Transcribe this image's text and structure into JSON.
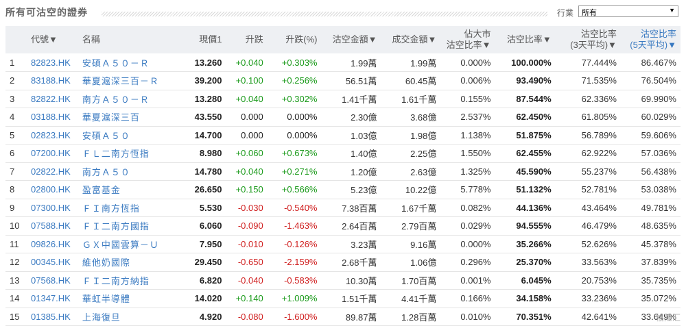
{
  "header": {
    "title": "所有可沽空的證券",
    "filter_label": "行業",
    "filter_value": "所有"
  },
  "columns": [
    {
      "key": "code",
      "label": "代號▼",
      "align": "l"
    },
    {
      "key": "name",
      "label": "名稱",
      "align": "l"
    },
    {
      "key": "price",
      "label": "現價1",
      "align": "r"
    },
    {
      "key": "chg",
      "label": "升跌",
      "align": "r"
    },
    {
      "key": "chgpct",
      "label": "升跌(%)",
      "align": "r"
    },
    {
      "key": "short_amt",
      "label": "沽空金額▼",
      "align": "r"
    },
    {
      "key": "turnover",
      "label": "成交金額▼",
      "align": "r"
    },
    {
      "key": "mkt_ratio",
      "label": "佔大市\n沽空比率▼",
      "align": "r"
    },
    {
      "key": "short_ratio",
      "label": "沽空比率▼",
      "align": "r"
    },
    {
      "key": "avg3",
      "label": "沽空比率\n(3天平均)▼",
      "align": "r"
    },
    {
      "key": "avg5",
      "label": "沽空比率\n(5天平均)▼",
      "align": "r",
      "sorted": true
    }
  ],
  "rows": [
    {
      "n": "1",
      "code": "82823.HK",
      "name": "安碩Ａ５０－Ｒ",
      "price": "13.260",
      "chg": "+0.040",
      "chgpct": "+0.303%",
      "dir": "up",
      "short_amt": "1.99萬",
      "turnover": "1.99萬",
      "mkt_ratio": "0.000%",
      "short_ratio": "100.000%",
      "avg3": "77.444%",
      "avg5": "86.467%"
    },
    {
      "n": "2",
      "code": "83188.HK",
      "name": "華夏滬深三百－Ｒ",
      "price": "39.200",
      "chg": "+0.100",
      "chgpct": "+0.256%",
      "dir": "up",
      "short_amt": "56.51萬",
      "turnover": "60.45萬",
      "mkt_ratio": "0.006%",
      "short_ratio": "93.490%",
      "avg3": "71.535%",
      "avg5": "76.504%"
    },
    {
      "n": "3",
      "code": "82822.HK",
      "name": "南方Ａ５０－Ｒ",
      "price": "13.280",
      "chg": "+0.040",
      "chgpct": "+0.302%",
      "dir": "up",
      "short_amt": "1.41千萬",
      "turnover": "1.61千萬",
      "mkt_ratio": "0.155%",
      "short_ratio": "87.544%",
      "avg3": "62.336%",
      "avg5": "69.990%"
    },
    {
      "n": "4",
      "code": "03188.HK",
      "name": "華夏滬深三百",
      "price": "43.550",
      "chg": "0.000",
      "chgpct": "0.000%",
      "dir": "flat",
      "short_amt": "2.30億",
      "turnover": "3.68億",
      "mkt_ratio": "2.537%",
      "short_ratio": "62.450%",
      "avg3": "61.805%",
      "avg5": "60.029%"
    },
    {
      "n": "5",
      "code": "02823.HK",
      "name": "安碩Ａ５０",
      "price": "14.700",
      "chg": "0.000",
      "chgpct": "0.000%",
      "dir": "flat",
      "short_amt": "1.03億",
      "turnover": "1.98億",
      "mkt_ratio": "1.138%",
      "short_ratio": "51.875%",
      "avg3": "56.789%",
      "avg5": "59.606%"
    },
    {
      "n": "6",
      "code": "07200.HK",
      "name": "ＦＬ二南方恆指",
      "price": "8.980",
      "chg": "+0.060",
      "chgpct": "+0.673%",
      "dir": "up",
      "short_amt": "1.40億",
      "turnover": "2.25億",
      "mkt_ratio": "1.550%",
      "short_ratio": "62.455%",
      "avg3": "62.922%",
      "avg5": "57.036%"
    },
    {
      "n": "7",
      "code": "02822.HK",
      "name": "南方Ａ５０",
      "price": "14.780",
      "chg": "+0.040",
      "chgpct": "+0.271%",
      "dir": "up",
      "short_amt": "1.20億",
      "turnover": "2.63億",
      "mkt_ratio": "1.325%",
      "short_ratio": "45.590%",
      "avg3": "55.237%",
      "avg5": "56.438%"
    },
    {
      "n": "8",
      "code": "02800.HK",
      "name": "盈富基金",
      "price": "26.650",
      "chg": "+0.150",
      "chgpct": "+0.566%",
      "dir": "up",
      "short_amt": "5.23億",
      "turnover": "10.22億",
      "mkt_ratio": "5.778%",
      "short_ratio": "51.132%",
      "avg3": "52.781%",
      "avg5": "53.038%"
    },
    {
      "n": "9",
      "code": "07300.HK",
      "name": "ＦＩ南方恆指",
      "price": "5.530",
      "chg": "-0.030",
      "chgpct": "-0.540%",
      "dir": "down",
      "short_amt": "7.38百萬",
      "turnover": "1.67千萬",
      "mkt_ratio": "0.082%",
      "short_ratio": "44.136%",
      "avg3": "43.464%",
      "avg5": "49.781%"
    },
    {
      "n": "10",
      "code": "07588.HK",
      "name": "ＦＩ二南方國指",
      "price": "6.060",
      "chg": "-0.090",
      "chgpct": "-1.463%",
      "dir": "down",
      "short_amt": "2.64百萬",
      "turnover": "2.79百萬",
      "mkt_ratio": "0.029%",
      "short_ratio": "94.555%",
      "avg3": "46.479%",
      "avg5": "48.635%"
    },
    {
      "n": "11",
      "code": "09826.HK",
      "name": "ＧＸ中國雲算－Ｕ",
      "price": "7.950",
      "chg": "-0.010",
      "chgpct": "-0.126%",
      "dir": "down",
      "short_amt": "3.23萬",
      "turnover": "9.16萬",
      "mkt_ratio": "0.000%",
      "short_ratio": "35.266%",
      "avg3": "52.626%",
      "avg5": "45.378%"
    },
    {
      "n": "12",
      "code": "00345.HK",
      "name": "維他奶國際",
      "price": "29.450",
      "chg": "-0.650",
      "chgpct": "-2.159%",
      "dir": "down",
      "short_amt": "2.68千萬",
      "turnover": "1.06億",
      "mkt_ratio": "0.296%",
      "short_ratio": "25.370%",
      "avg3": "33.563%",
      "avg5": "37.839%"
    },
    {
      "n": "13",
      "code": "07568.HK",
      "name": "ＦＩ二南方納指",
      "price": "6.820",
      "chg": "-0.040",
      "chgpct": "-0.583%",
      "dir": "down",
      "short_amt": "10.30萬",
      "turnover": "1.70百萬",
      "mkt_ratio": "0.001%",
      "short_ratio": "6.045%",
      "avg3": "20.753%",
      "avg5": "35.735%"
    },
    {
      "n": "14",
      "code": "01347.HK",
      "name": "華虹半導體",
      "price": "14.020",
      "chg": "+0.140",
      "chgpct": "+1.009%",
      "dir": "up",
      "short_amt": "1.51千萬",
      "turnover": "4.41千萬",
      "mkt_ratio": "0.166%",
      "short_ratio": "34.158%",
      "avg3": "33.236%",
      "avg5": "35.072%"
    },
    {
      "n": "15",
      "code": "01385.HK",
      "name": "上海復旦",
      "price": "4.920",
      "chg": "-0.080",
      "chgpct": "-1.600%",
      "dir": "down",
      "short_amt": "89.87萬",
      "turnover": "1.28百萬",
      "mkt_ratio": "0.010%",
      "short_ratio": "70.351%",
      "avg3": "42.641%",
      "avg5": "33.649%"
    }
  ],
  "watermark": "格隆汇",
  "colors": {
    "accent": "#3a7ac1",
    "up": "#1a9a1a",
    "down": "#d02020"
  }
}
